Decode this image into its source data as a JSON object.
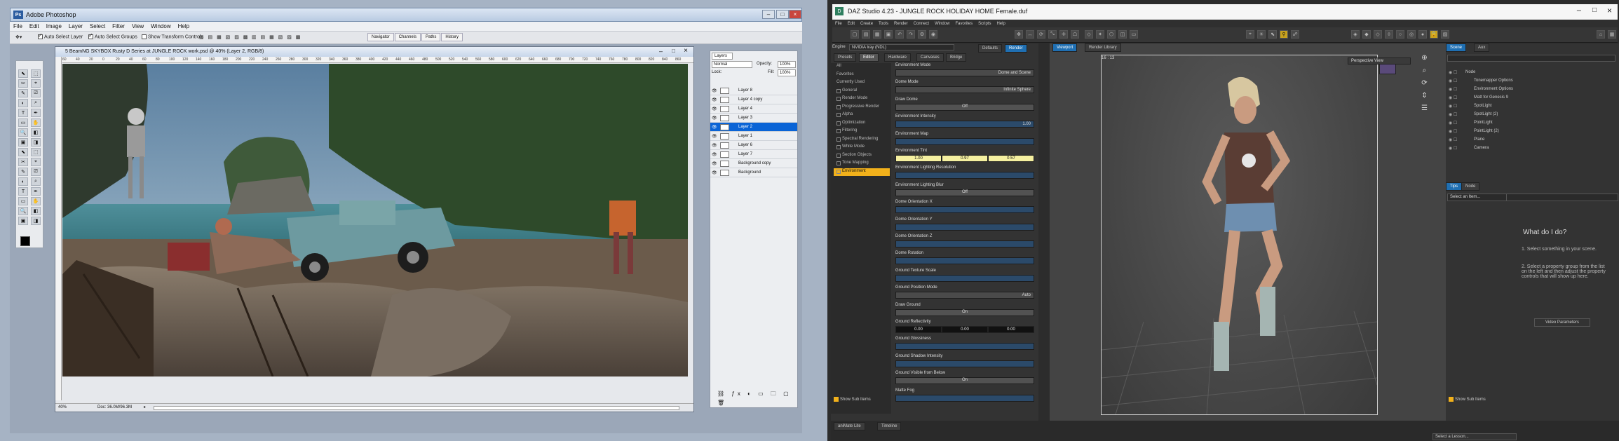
{
  "photoshop": {
    "window_title": "Adobe Photoshop",
    "menu": [
      "File",
      "Edit",
      "Image",
      "Layer",
      "Select",
      "Filter",
      "View",
      "Window",
      "Help"
    ],
    "options": {
      "auto_select_layer": "Auto Select Layer",
      "auto_select_groups": "Auto Select Groups",
      "show_transform": "Show Transform Controls"
    },
    "panel_tabs": [
      "Navigator",
      "Channels",
      "Paths",
      "History"
    ],
    "doc_title": "5 BeamNG SKYBOX Rusty D Series at JUNGLE ROCK work.psd @ 40% (Layer 2, RGB/8)",
    "status_zoom": "40%",
    "status_doc": "Doc: 36.0M/96.3M",
    "ruler_marks": [
      "60",
      "40",
      "20",
      "0",
      "20",
      "40",
      "60",
      "80",
      "100",
      "120",
      "140",
      "160",
      "180",
      "200",
      "220",
      "240",
      "260",
      "280",
      "300",
      "320",
      "340",
      "360",
      "380",
      "400",
      "420",
      "440",
      "460",
      "480",
      "500",
      "520",
      "540",
      "560",
      "580",
      "600",
      "620",
      "640",
      "660",
      "680",
      "700",
      "720",
      "740",
      "760",
      "780",
      "800",
      "820",
      "840",
      "860"
    ],
    "layers_panel": {
      "title": "Layers",
      "blend": "Normal",
      "opacity_label": "Opacity:",
      "opacity": "100%",
      "fill_label": "Fill:",
      "fill": "100%",
      "lock_label": "Lock:"
    },
    "layers": [
      {
        "name": "Layer 8",
        "selected": false
      },
      {
        "name": "Layer 4 copy",
        "selected": false
      },
      {
        "name": "Layer 4",
        "selected": false
      },
      {
        "name": "Layer 3",
        "selected": false
      },
      {
        "name": "Layer 2",
        "selected": true
      },
      {
        "name": "Layer 1",
        "selected": false
      },
      {
        "name": "Layer 6",
        "selected": false
      },
      {
        "name": "Layer 7",
        "selected": false
      },
      {
        "name": "Background copy",
        "selected": false
      },
      {
        "name": "Background",
        "selected": false
      }
    ]
  },
  "daz": {
    "window_title": "DAZ Studio 4.23 - JUNGLE ROCK HOLIDAY HOME Female.duf",
    "menu": [
      "File",
      "Edit",
      "Create",
      "Tools",
      "Render",
      "Connect",
      "Window",
      "Favorites",
      "Scripts",
      "Help"
    ],
    "engine_label": "Engine",
    "engine_value": "NVIDIA Iray (NDL)",
    "tabs_top": [
      "Defaults",
      "Render"
    ],
    "tabs_sub": [
      "Presets",
      "Editor",
      "Hardware",
      "Canvases",
      "Bridge"
    ],
    "categories": [
      "All",
      "Favorites",
      "Currently Used",
      "General",
      "Render Mode",
      "Progressive Render",
      "Alpha",
      "Optimization",
      "Filtering",
      "Spectral Rendering",
      "White Mode",
      "Section Objects",
      "Tone Mapping",
      "Environment"
    ],
    "selected_category": "Environment",
    "show_sub_items": "Show Sub Items",
    "properties": [
      {
        "label": "Environment Mode",
        "value": "Dome and Scene",
        "kind": "dd"
      },
      {
        "label": "Dome Mode",
        "value": "Infinite Sphere",
        "kind": "dd"
      },
      {
        "label": "Draw Dome",
        "value": "Off",
        "kind": "btn"
      },
      {
        "label": "Environment Intensity",
        "value": "1.00",
        "kind": "bar"
      },
      {
        "label": "Environment Map",
        "value": "",
        "kind": "bar"
      },
      {
        "label": "Environment Tint",
        "values": [
          "1.00",
          "0.97",
          "0.57"
        ],
        "kind": "tri"
      },
      {
        "label": "Environment Lighting Resolution",
        "value": "",
        "kind": "bar"
      },
      {
        "label": "Environment Lighting Blur",
        "value": "Off",
        "kind": "btn"
      },
      {
        "label": "Dome Orientation X",
        "value": "",
        "kind": "bar"
      },
      {
        "label": "Dome Orientation Y",
        "value": "",
        "kind": "bar"
      },
      {
        "label": "Dome Orientation Z",
        "value": "",
        "kind": "bar"
      },
      {
        "label": "Dome Rotation",
        "value": "",
        "kind": "bar"
      },
      {
        "label": "Ground Texture Scale",
        "value": "",
        "kind": "bar"
      },
      {
        "label": "Ground Position Mode",
        "value": "Auto",
        "kind": "dd"
      },
      {
        "label": "Draw Ground",
        "value": "On",
        "kind": "btn"
      },
      {
        "label": "Ground Reflectivity",
        "values": [
          "0.00",
          "0.00",
          "0.00"
        ],
        "kind": "tri"
      },
      {
        "label": "Ground Glossiness",
        "value": "",
        "kind": "bar"
      },
      {
        "label": "Ground Shadow Intensity",
        "value": "",
        "kind": "bar"
      },
      {
        "label": "Ground Visible from Below",
        "value": "On",
        "kind": "btn"
      },
      {
        "label": "Matte Fog",
        "value": "",
        "kind": "bar"
      }
    ],
    "viewport_tabs": [
      "Viewport",
      "Render Library"
    ],
    "perspective_view": "Perspective View",
    "viewport_info": "16 : 13",
    "scene_tabs": [
      "Scene",
      "Aux"
    ],
    "scene_search": "",
    "scene_items": [
      "Node",
      "Tonemapper Options",
      "Environment Options",
      "Matt for Genesis 9",
      "SpotLight",
      "SpotLight (2)",
      "PointLight",
      "PointLight (2)",
      "Plane",
      "Camera"
    ],
    "tips_tabs": [
      "Tips",
      "Node"
    ],
    "select_an_item": "Select an Item...",
    "what_do_i_do": "What do I do?",
    "step1": "1. Select something in your scene.",
    "step2": "2. Select a property group from the list on the left and then adjust the property controls that will show up here.",
    "video_button": "Video Parameters",
    "show_sub_items_right": "Show Sub Items",
    "bottom_tabs": [
      "aniMate Lite",
      "Timeline"
    ],
    "lesson": "Select a Lesson..."
  },
  "colors": {
    "ps_select": "#0a64d6",
    "daz_accent": "#f2b11b",
    "daz_render": "#1f6fb2"
  }
}
